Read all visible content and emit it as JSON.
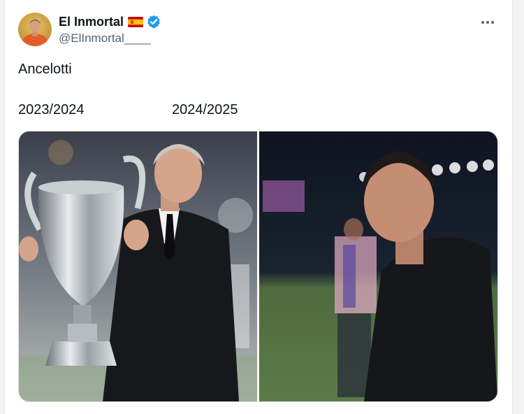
{
  "author": {
    "display_name": "El Inmortal",
    "handle": "@ElInmortal____"
  },
  "icons": {
    "flag": "spain-flag-icon",
    "verified": "verified-badge-icon",
    "more": "more-options-icon"
  },
  "colors": {
    "verified_blue": "#1d9bf0",
    "text_primary": "#0f1419",
    "text_secondary": "#536471"
  },
  "tweet": {
    "line1": "Ancelotti",
    "season_left": "2023/2024",
    "season_right": "2024/2025"
  }
}
